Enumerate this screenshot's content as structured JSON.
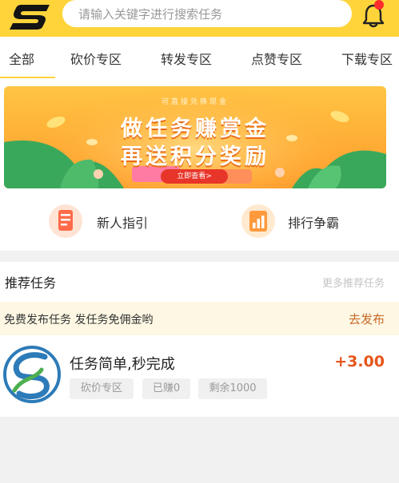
{
  "colors": {
    "brand_yellow": "#ffd43b",
    "reward_orange": "#e7551a",
    "notice_bg": "#fdf7e3",
    "action_orange": "#c7692a"
  },
  "header": {
    "logo_icon": "s-logo-icon",
    "search_placeholder": "请输入关键字进行搜索任务",
    "bell_icon": "bell-icon"
  },
  "tabs": [
    {
      "label": "全部",
      "active": true
    },
    {
      "label": "砍价专区"
    },
    {
      "label": "转发专区"
    },
    {
      "label": "点赞专区"
    },
    {
      "label": "下载专区"
    }
  ],
  "banner": {
    "subtitle": "可直接兑换现金",
    "title_line1": "做任务赚赏金",
    "title_line2": "再送积分奖励",
    "button": "立即查看>"
  },
  "shortcuts": [
    {
      "label": "新人指引",
      "icon": "guide-icon"
    },
    {
      "label": "排行争霸",
      "icon": "ranking-icon"
    }
  ],
  "recommend": {
    "title": "推荐任务",
    "more": "更多推荐任务",
    "notice": "免费发布任务 发任务免佣金哟",
    "notice_action": "去发布"
  },
  "tasks": [
    {
      "name": "任务简单,秒完成",
      "reward": "+3.00",
      "tags": [
        "砍价专区",
        "已赚0",
        "剩余1000"
      ]
    }
  ]
}
